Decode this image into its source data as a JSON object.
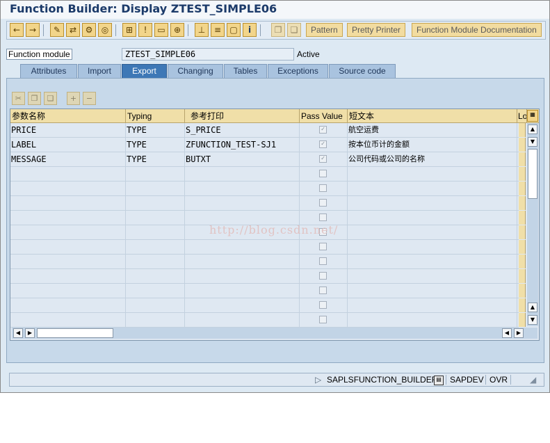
{
  "window": {
    "title": "Function Builder: Display ZTEST_SIMPLE06"
  },
  "toolbar": {
    "pattern_label": "Pattern",
    "pretty_printer_label": "Pretty Printer",
    "documentation_label": "Function Module Documentation"
  },
  "function_module": {
    "label": "Function module",
    "value": "ZTEST_SIMPLE06",
    "status": "Active"
  },
  "tabs": [
    "Attributes",
    "Import",
    "Export",
    "Changing",
    "Tables",
    "Exceptions",
    "Source code"
  ],
  "active_tab": "Export",
  "grid": {
    "headers": [
      "参数名称",
      "Typing",
      "参考打印",
      "Pass Value",
      "短文本",
      "Lo"
    ],
    "rows": [
      {
        "name": "PRICE",
        "typing": "TYPE",
        "ref": "S_PRICE",
        "pass_value": true,
        "text": "航空运费"
      },
      {
        "name": "LABEL",
        "typing": "TYPE",
        "ref": "ZFUNCTION_TEST-SJ1",
        "pass_value": true,
        "text": "按本位币计的金额"
      },
      {
        "name": "MESSAGE",
        "typing": "TYPE",
        "ref": "BUTXT",
        "pass_value": true,
        "text": "公司代码或公司的名称"
      }
    ],
    "empty_rows": 11
  },
  "watermark": "http://blog.csdn.net/",
  "status_bar": {
    "program": "SAPLSFUNCTION_BUILDER",
    "system": "SAPDEV",
    "mode": "OVR"
  },
  "colors": {
    "title": "#1b3a69",
    "active_tab": "#3e78b6",
    "tab": "#a9c3df",
    "header": "#f0dfa8",
    "background": "#dde9f3"
  }
}
